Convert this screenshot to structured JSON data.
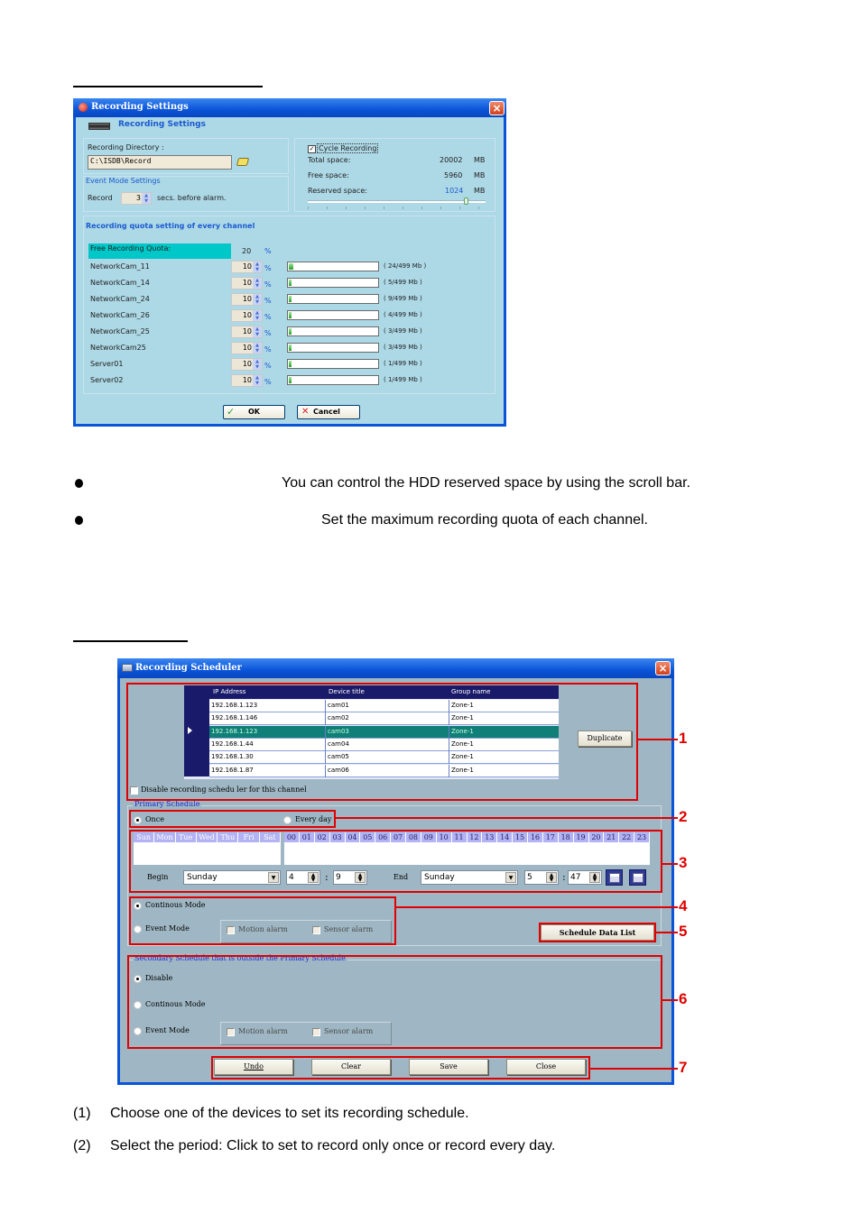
{
  "recording_settings": {
    "window_title": "Recording Settings",
    "header_title": "Recording  Settings",
    "recording_directory_label": "Recording Directory :",
    "recording_directory_value": "C:\\ISDB\\Record",
    "event_mode_label": "Event Mode Settings",
    "record_label": "Record",
    "record_seconds": "3",
    "record_suffix": "secs. before alarm.",
    "cycle_recording_label": "Cycle Recording",
    "cycle_recording_checked": true,
    "total_space_label": "Total space:",
    "total_space_value": "20002",
    "free_space_label": "Free space:",
    "free_space_value": "5960",
    "reserved_space_label": "Reserved space:",
    "reserved_space_value": "1024",
    "unit_mb": "MB",
    "reserved_slider_fraction": 0.9,
    "quota_section_title": "Recording quota setting of every channel",
    "free_quota_label": "Free Recording Quota:",
    "free_quota_value": "20",
    "percent": "%",
    "channels": [
      {
        "name": "NetworkCam_11",
        "quota": "10",
        "usage": "( 24/499 Mb )",
        "used": 24,
        "total": 499
      },
      {
        "name": "NetworkCam_14",
        "quota": "10",
        "usage": "( 5/499 Mb )",
        "used": 5,
        "total": 499
      },
      {
        "name": "NetworkCam_24",
        "quota": "10",
        "usage": "( 9/499 Mb )",
        "used": 9,
        "total": 499
      },
      {
        "name": "NetworkCam_26",
        "quota": "10",
        "usage": "( 4/499 Mb )",
        "used": 4,
        "total": 499
      },
      {
        "name": "NetworkCam_25",
        "quota": "10",
        "usage": "( 3/499 Mb )",
        "used": 3,
        "total": 499
      },
      {
        "name": "NetworkCam25",
        "quota": "10",
        "usage": "( 3/499 Mb )",
        "used": 3,
        "total": 499
      },
      {
        "name": "Server01",
        "quota": "10",
        "usage": "( 1/499 Mb )",
        "used": 1,
        "total": 499
      },
      {
        "name": "Server02",
        "quota": "10",
        "usage": "( 1/499 Mb )",
        "used": 1,
        "total": 499
      }
    ],
    "ok_label": "OK",
    "cancel_label": "Cancel"
  },
  "bullets": [
    "You can control the HDD reserved space by using the scroll bar.",
    "Set the maximum recording quota of each channel."
  ],
  "scheduler": {
    "window_title": "Recording Scheduler",
    "columns": [
      "IP Address",
      "Device title",
      "Group name"
    ],
    "rows": [
      {
        "ip": "192.168.1.123",
        "title": "cam01",
        "group": "Zone-1",
        "selected": false
      },
      {
        "ip": "192.168.1.146",
        "title": "cam02",
        "group": "Zone-1",
        "selected": false
      },
      {
        "ip": "192.168.1.123",
        "title": "cam03",
        "group": "Zone-1",
        "selected": true
      },
      {
        "ip": "192.168.1.44",
        "title": "cam04",
        "group": "Zone-1",
        "selected": false
      },
      {
        "ip": "192.168.1.30",
        "title": "cam05",
        "group": "Zone-1",
        "selected": false
      },
      {
        "ip": "192.168.1.87",
        "title": "cam06",
        "group": "Zone-1",
        "selected": false
      }
    ],
    "duplicate_label": "Duplicate",
    "disable_label": "Disable recording schedu ler for this channel",
    "primary_legend": "Primary Schedule",
    "once_label": "Once",
    "every_day_label": "Every day",
    "days": [
      "Sun",
      "Mon",
      "Tue",
      "Wed",
      "Thu",
      "Fri",
      "Sat"
    ],
    "hours": [
      "00",
      "01",
      "02",
      "03",
      "04",
      "05",
      "06",
      "07",
      "08",
      "09",
      "10",
      "11",
      "12",
      "13",
      "14",
      "15",
      "16",
      "17",
      "18",
      "19",
      "20",
      "21",
      "22",
      "23"
    ],
    "begin_label": "Begin",
    "begin_day": "Sunday",
    "begin_hour": "4",
    "begin_minute": "9",
    "end_label": "End",
    "end_day": "Sunday",
    "end_hour": "5",
    "end_minute": "47",
    "colon": ":",
    "continuous_mode_label": "Continous Mode",
    "event_mode_label": "Event Mode",
    "motion_alarm_label": "Motion alarm",
    "sensor_alarm_label": "Sensor alarm",
    "schedule_data_list_label": "Schedule Data List",
    "secondary_legend": "Secondary Schedule that is outside the Primary Schedule",
    "disable_option_label": "Disable",
    "undo_label": "Undo",
    "clear_label": "Clear",
    "save_label": "Save",
    "close_label": "Close",
    "callouts": [
      "1",
      "2",
      "3",
      "4",
      "5",
      "6",
      "7"
    ]
  },
  "steps": [
    {
      "num": "(1)",
      "text": "Choose one of the devices to set its recording schedule."
    },
    {
      "num": "(2)",
      "text": "Select the period: Click to set to record only once or record every day."
    }
  ]
}
